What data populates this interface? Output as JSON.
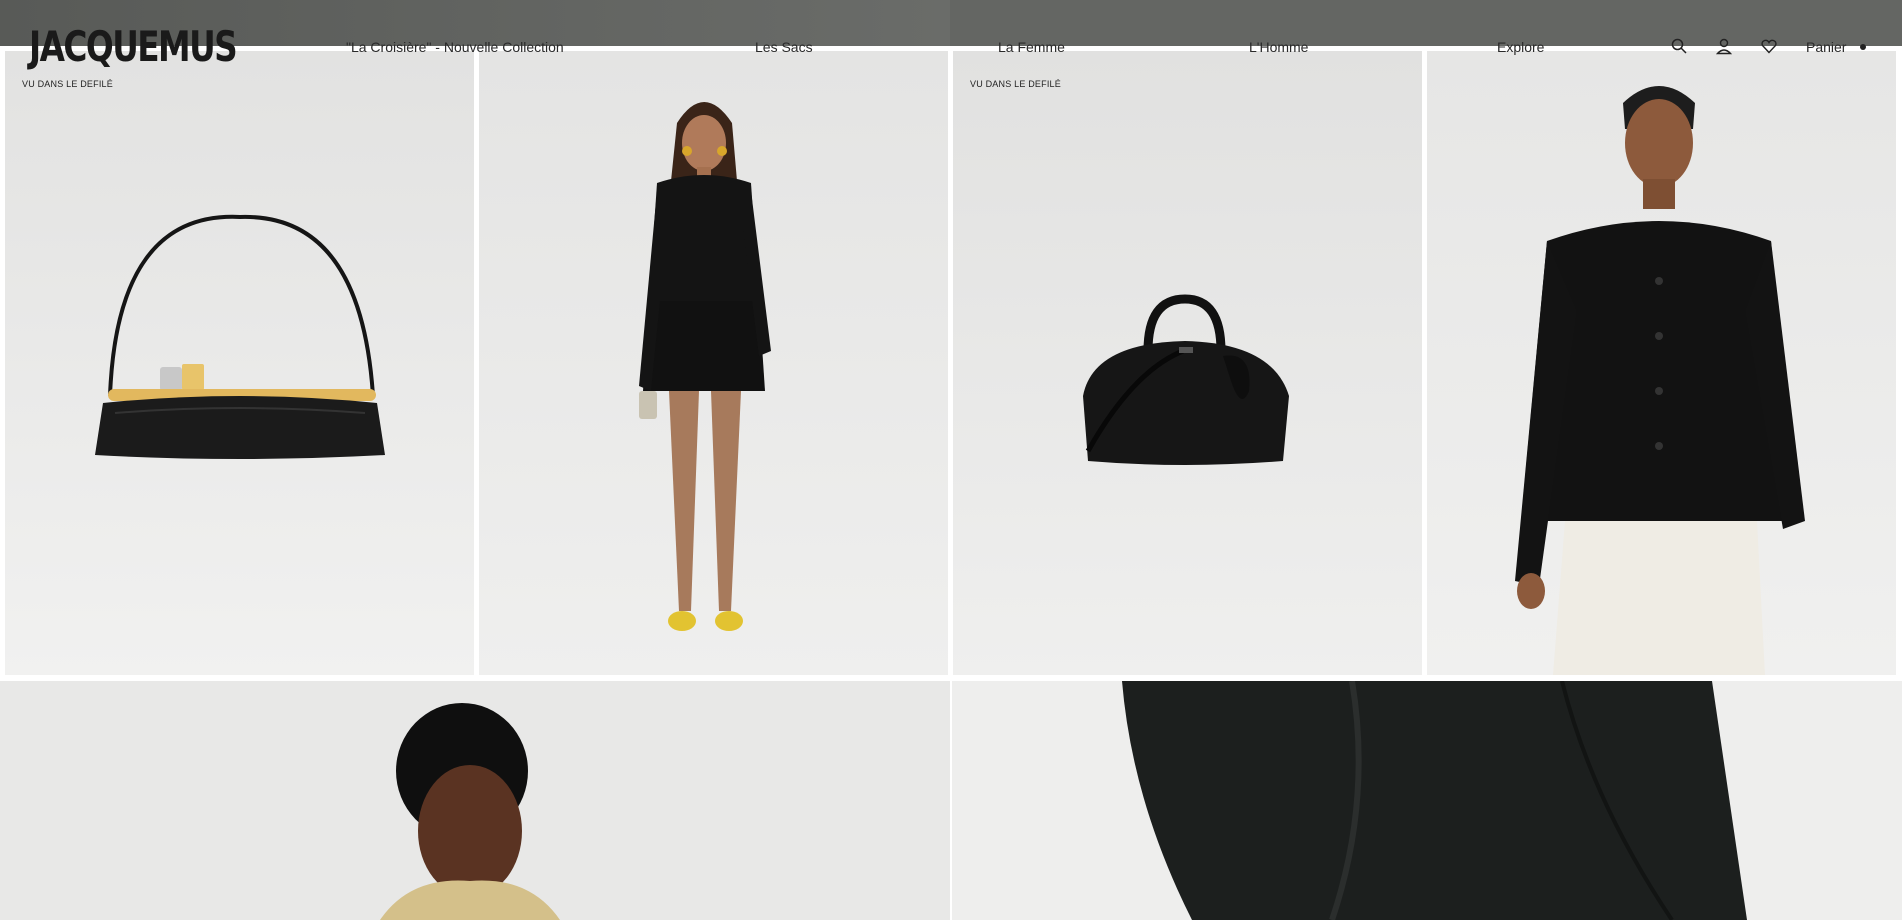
{
  "brand": {
    "logo": "JACQUEMUS"
  },
  "nav": {
    "items": [
      {
        "label": "\"La Croisière\" - Nouvelle Collection"
      },
      {
        "label": "Les Sacs"
      },
      {
        "label": "La Femme"
      },
      {
        "label": "L'Homme"
      },
      {
        "label": "Explore"
      }
    ]
  },
  "header_icons": [
    "search-icon",
    "account-icon",
    "wishlist-icon"
  ],
  "cart": {
    "label": "Panier"
  },
  "products": [
    {
      "badge": "VU DANS LE DEFILÉ",
      "subject": "black clutch bag with gold frame and strap"
    },
    {
      "badge": "",
      "subject": "model in black draped mini dress with yellow heels"
    },
    {
      "badge": "VU DANS LE DEFILÉ",
      "subject": "black leather bowling bag"
    },
    {
      "badge": "",
      "subject": "model in black knit cardigan and cream trousers"
    }
  ],
  "colors": {
    "header_band": "#5f615e",
    "card_bg": "#e9e9e9",
    "text": "#2a2a2a"
  }
}
